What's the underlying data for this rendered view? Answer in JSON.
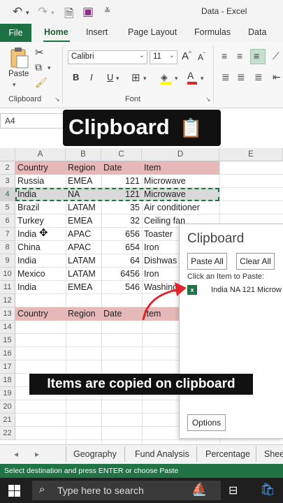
{
  "window": {
    "title": "Data - Excel"
  },
  "ribbon_tabs": [
    "File",
    "Home",
    "Insert",
    "Page Layout",
    "Formulas",
    "Data"
  ],
  "ribbon": {
    "paste_label": "Paste",
    "clipboard_group": "Clipboard",
    "font_group": "Font",
    "font_name": "Calibri",
    "font_size": "11",
    "bold": "B",
    "italic": "I",
    "underline": "U",
    "grow_font": "A",
    "shrink_font": "A",
    "font_color": "A"
  },
  "name_box": "A4",
  "overlay_title": "Clipboard",
  "overlay_caption": "Items are copied on clipboard",
  "columns": [
    "A",
    "B",
    "C",
    "D",
    "E"
  ],
  "row_numbers": [
    "2",
    "3",
    "4",
    "5",
    "6",
    "7",
    "8",
    "9",
    "10",
    "11",
    "12",
    "13",
    "14",
    "15",
    "16",
    "17",
    "18",
    "19",
    "20",
    "21",
    "22"
  ],
  "table_header": [
    "Country",
    "Region",
    "Date",
    "Item"
  ],
  "table_rows": [
    [
      "Russia",
      "EMEA",
      "121",
      "Microwave"
    ],
    [
      "India",
      "NA",
      "121",
      "Microwave"
    ],
    [
      "Brazil",
      "LATAM",
      "35",
      "Air conditioner"
    ],
    [
      "Turkey",
      "EMEA",
      "32",
      "Ceiling fan"
    ],
    [
      "India",
      "APAC",
      "656",
      "Toaster"
    ],
    [
      "China",
      "APAC",
      "654",
      "Iron"
    ],
    [
      "India",
      "LATAM",
      "64",
      "Dishwas"
    ],
    [
      "Mexico",
      "LATAM",
      "6456",
      "Iron"
    ],
    [
      "India",
      "EMEA",
      "546",
      "Washing"
    ]
  ],
  "second_header": [
    "Country",
    "Region",
    "Date",
    "Item"
  ],
  "clipboard_pane": {
    "title": "Clipboard",
    "paste_all": "Paste All",
    "clear_all": "Clear All",
    "instruction": "Click an Item to Paste:",
    "item": "India NA 121 Microw",
    "options": "Options"
  },
  "sheet_tabs": [
    "Geography",
    "Fund Analysis",
    "Percentage",
    "Shee"
  ],
  "status_text": "Select destination and press ENTER or choose Paste",
  "taskbar": {
    "search_placeholder": "Type here to search"
  },
  "colors": {
    "excel_green": "#1e7145",
    "header_fill": "#e6b8b7",
    "selection_fill": "#d9d9d9",
    "arrow_red": "#e0262a"
  }
}
